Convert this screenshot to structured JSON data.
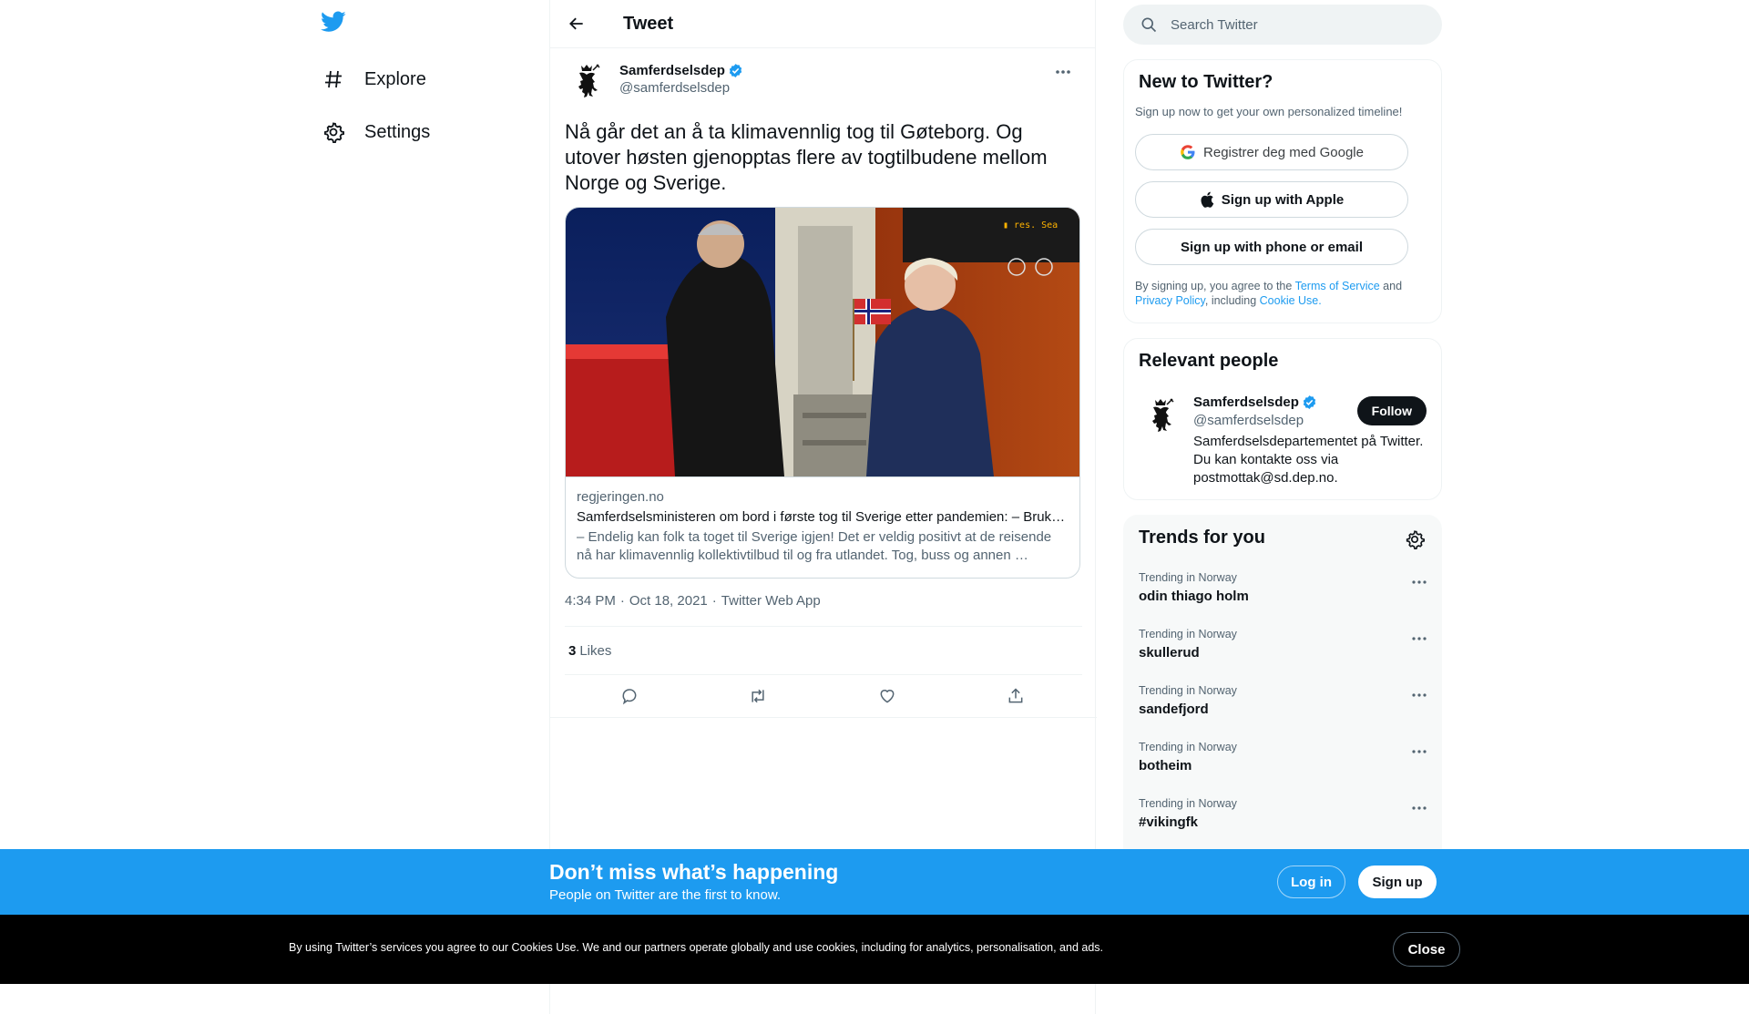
{
  "colors": {
    "brand": "#1d9bf0",
    "text": "#0f1419",
    "secondary": "#536471",
    "border": "#eff3f4",
    "banner": "#1d9bf0",
    "cookie_bg": "#000000"
  },
  "nav": {
    "logo_icon": "twitter-bird-icon",
    "items": [
      {
        "label": "Explore",
        "icon": "hashtag-icon"
      },
      {
        "label": "Settings",
        "icon": "gear-icon"
      }
    ]
  },
  "header": {
    "title": "Tweet",
    "back_icon": "arrow-left-icon"
  },
  "tweet": {
    "author": {
      "display_name": "Samferdselsdep",
      "handle": "@samferdselsdep",
      "verified": true,
      "avatar_icon": "norwegian-lion-crest-icon"
    },
    "text": "Nå går det an å ta klimavennlig tog til Gøteborg. Og\nutover høsten gjenopptas flere av togtilbudene mellom\nNorge og Sverige.",
    "card": {
      "domain": "regjeringen.no",
      "title": "Samferdselsministeren om bord i første tog til Sverige etter pandemien: – Bruk …",
      "description": "– Endelig kan folk ta toget til Sverige igjen! Det er veldig positivt at de reisende nå har klimavennlig kollektivtilbud til og fra utlandet. Tog, buss og annen …",
      "image_icon": "train-photo-image"
    },
    "time": "4:34 PM",
    "date": "Oct 18, 2021",
    "source": "Twitter Web App",
    "separator": "·",
    "likes_count": "3",
    "likes_label": "Likes",
    "actions": [
      "reply-icon",
      "retweet-icon",
      "like-icon",
      "share-icon"
    ]
  },
  "search": {
    "placeholder": "Search Twitter"
  },
  "new_to_twitter": {
    "title": "New to Twitter?",
    "subtitle": "Sign up now to get your own personalized timeline!",
    "google_label": "Registrer deg med Google",
    "apple_label": "Sign up with Apple",
    "phone_label": "Sign up with phone or email",
    "legal_prefix": "By signing up, you agree to the ",
    "terms": "Terms of Service",
    "and": " and ",
    "privacy": "Privacy Policy",
    "including": ", including ",
    "cookie": "Cookie Use."
  },
  "relevant_people": {
    "title": "Relevant people",
    "name": "Samferdselsdep",
    "handle": "@samferdselsdep",
    "follow_label": "Follow",
    "bio": "Samferdselsdepartementet på Twitter. Du kan kontakte oss via postmottak@sd.dep.no."
  },
  "trends": {
    "title": "Trends for you",
    "items": [
      {
        "context": "Trending in Norway",
        "name": "odin thiago holm"
      },
      {
        "context": "Trending in Norway",
        "name": "skullerud"
      },
      {
        "context": "Trending in Norway",
        "name": "sandefjord"
      },
      {
        "context": "Trending in Norway",
        "name": "botheim"
      },
      {
        "context": "Trending in Norway",
        "name": "#vikingfk"
      }
    ]
  },
  "banner": {
    "title": "Don’t miss what’s happening",
    "subtitle": "People on Twitter are the first to know.",
    "login_label": "Log in",
    "signup_label": "Sign up"
  },
  "cookie": {
    "text": "By using Twitter’s services you agree to our Cookies Use. We and our partners operate globally and use cookies, including for analytics, personalisation, and ads.",
    "close_label": "Close"
  }
}
